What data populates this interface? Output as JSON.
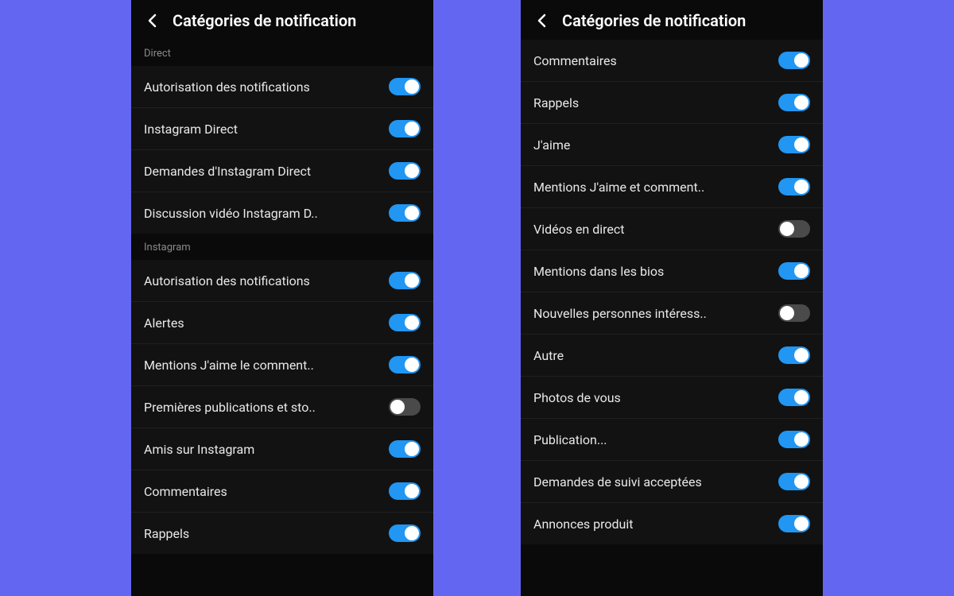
{
  "left": {
    "header": {
      "title": "Catégories de notification"
    },
    "sections": [
      {
        "name": "Direct",
        "items": [
          {
            "label": "Autorisation des notifications",
            "on": true
          },
          {
            "label": "Instagram Direct",
            "on": true
          },
          {
            "label": "Demandes d'Instagram Direct",
            "on": true
          },
          {
            "label": "Discussion vidéo Instagram D..",
            "on": true
          }
        ]
      },
      {
        "name": "Instagram",
        "items": [
          {
            "label": "Autorisation des notifications",
            "on": true
          },
          {
            "label": "Alertes",
            "on": true
          },
          {
            "label": "Mentions J'aime le comment..",
            "on": true
          },
          {
            "label": "Premières publications et sto..",
            "on": false
          },
          {
            "label": "Amis sur Instagram",
            "on": true
          },
          {
            "label": "Commentaires",
            "on": true
          },
          {
            "label": "Rappels",
            "on": true
          }
        ]
      }
    ]
  },
  "right": {
    "header": {
      "title": "Catégories de notification"
    },
    "items": [
      {
        "label": "Commentaires",
        "on": true
      },
      {
        "label": "Rappels",
        "on": true
      },
      {
        "label": "J'aime",
        "on": true
      },
      {
        "label": "Mentions J'aime et comment..",
        "on": true
      },
      {
        "label": "Vidéos en direct",
        "on": false
      },
      {
        "label": "Mentions dans les bios",
        "on": true
      },
      {
        "label": "Nouvelles personnes intéress..",
        "on": false
      },
      {
        "label": "Autre",
        "on": true
      },
      {
        "label": "Photos de vous",
        "on": true
      },
      {
        "label": "Publication...",
        "on": true
      },
      {
        "label": "Demandes de suivi acceptées",
        "on": true
      },
      {
        "label": "Annonces produit",
        "on": true
      }
    ]
  }
}
